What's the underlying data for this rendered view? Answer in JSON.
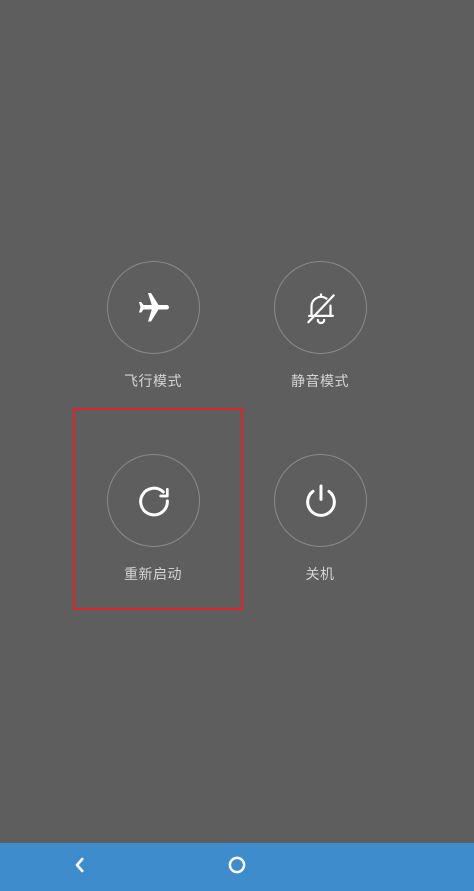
{
  "power_menu": {
    "items": [
      {
        "id": "airplane",
        "label": "飞行模式",
        "icon": "airplane-icon"
      },
      {
        "id": "silent",
        "label": "静音模式",
        "icon": "bell-off-icon"
      },
      {
        "id": "reboot",
        "label": "重新启动",
        "icon": "restart-icon"
      },
      {
        "id": "power_off",
        "label": "关机",
        "icon": "power-icon"
      }
    ],
    "highlighted_item": "reboot"
  },
  "navbar": {
    "back_icon": "chevron-left-icon",
    "home_icon": "home-circle-icon"
  },
  "colors": {
    "background": "#5e5e5e",
    "circle_border": "#8a8a8a",
    "icon": "#ffffff",
    "label": "#d4d4d4",
    "highlight": "#e0232a",
    "navbar": "#3f8ccd"
  }
}
